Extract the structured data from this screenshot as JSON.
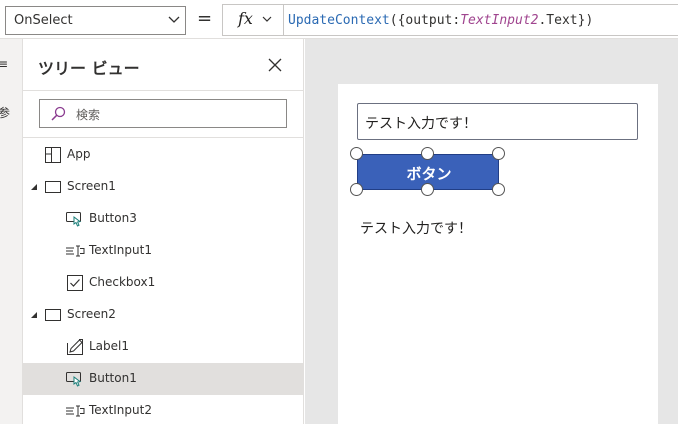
{
  "formula_bar": {
    "property": "OnSelect",
    "equals": "=",
    "fx_label": "fx",
    "formula": {
      "fn": "UpdateContext",
      "part1": "({output:",
      "ref": "TextInput2",
      "part2": ".Text})"
    }
  },
  "left_rail": {
    "icon_top": "≡",
    "icon_bottom": "参"
  },
  "tree_panel": {
    "title": "ツリー ビュー",
    "search_placeholder": "検索",
    "items": [
      {
        "label": "App",
        "icon": "app-icon",
        "expandable": false
      },
      {
        "label": "Screen1",
        "icon": "screen-icon",
        "expandable": true
      },
      {
        "label": "Button3",
        "icon": "button-icon",
        "expandable": false
      },
      {
        "label": "TextInput1",
        "icon": "textinput-icon",
        "expandable": false
      },
      {
        "label": "Checkbox1",
        "icon": "checkbox-icon",
        "expandable": false
      },
      {
        "label": "Screen2",
        "icon": "screen-icon",
        "expandable": true
      },
      {
        "label": "Label1",
        "icon": "label-icon",
        "expandable": false
      },
      {
        "label": "Button1",
        "icon": "button-icon",
        "expandable": false,
        "selected": true
      },
      {
        "label": "TextInput2",
        "icon": "textinput-icon",
        "expandable": false
      }
    ]
  },
  "canvas": {
    "text_input_value": "テスト入力です！",
    "button_label": "ボタン",
    "output_label": "テスト入力です！"
  },
  "colors": {
    "accent": "#3a61b9",
    "selected_row": "#e1dfdd",
    "canvas_background": "#e6e6e6",
    "formula_function": "#2b6ab3",
    "formula_reference": "#a0458f"
  }
}
